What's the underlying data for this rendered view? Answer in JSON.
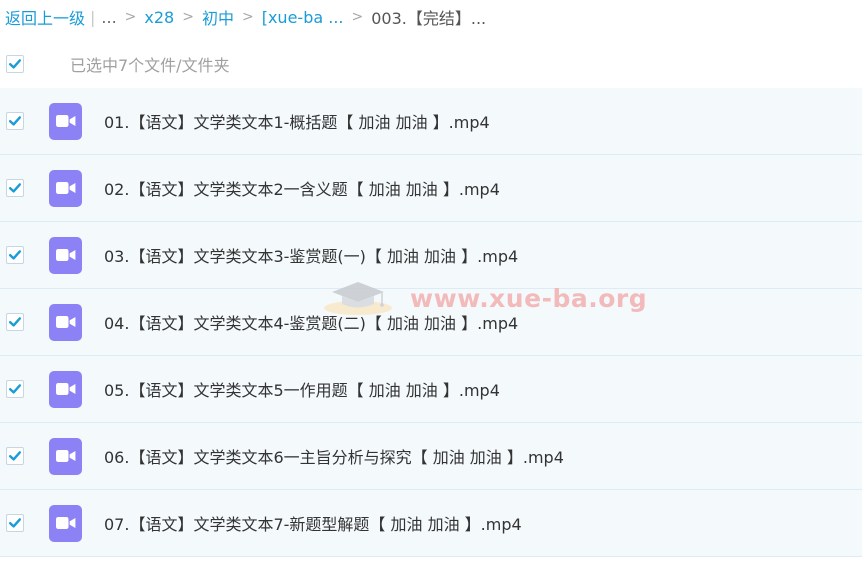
{
  "breadcrumb": {
    "back": "返回上一级",
    "separator": "|",
    "items": [
      "...",
      "x28",
      "初中",
      "[xue-ba ...",
      "003.【完结】..."
    ],
    "arrow": ">"
  },
  "select_all": {
    "label": "已选中7个文件/文件夹",
    "checked": true
  },
  "files": [
    {
      "name": "01.【语文】文学类文本1-概括题【 加油 加油 】.mp4",
      "checked": true,
      "icon": "video-file-icon"
    },
    {
      "name": "02.【语文】文学类文本2一含义题【 加油 加油 】.mp4",
      "checked": true,
      "icon": "video-file-icon"
    },
    {
      "name": "03.【语文】文学类文本3-鉴赏题(一)【 加油 加油 】.mp4",
      "checked": true,
      "icon": "video-file-icon"
    },
    {
      "name": "04.【语文】文学类文本4-鉴赏题(二)【 加油 加油 】.mp4",
      "checked": true,
      "icon": "video-file-icon"
    },
    {
      "name": "05.【语文】文学类文本5一作用题【 加油 加油 】.mp4",
      "checked": true,
      "icon": "video-file-icon"
    },
    {
      "name": "06.【语文】文学类文本6一主旨分析与探究【 加油 加油 】.mp4",
      "checked": true,
      "icon": "video-file-icon"
    },
    {
      "name": "07.【语文】文学类文本7-新题型解题【 加油 加油 】.mp4",
      "checked": true,
      "icon": "video-file-icon"
    }
  ],
  "watermark": {
    "text": "www.xue-ba.org"
  },
  "colors": {
    "accent": "#1a9cd8",
    "video_icon": "#8d82f5",
    "row_bg": "#f4f9fc",
    "row_border": "#dcebf5"
  }
}
